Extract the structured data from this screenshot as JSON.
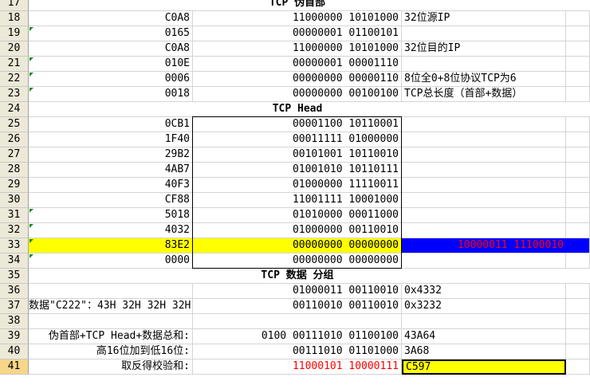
{
  "rows": [
    {
      "num": "17",
      "title": "TCP 伪首部"
    },
    {
      "num": "18",
      "a": "C0A8",
      "b": "11000000 10101000",
      "c": "32位源IP",
      "tri": false
    },
    {
      "num": "19",
      "a": "0165",
      "b": "00000001 01100101",
      "c": "",
      "tri": true
    },
    {
      "num": "20",
      "a": "C0A8",
      "b": "11000000 10101000",
      "c": "32位目的IP",
      "tri": false
    },
    {
      "num": "21",
      "a": "010E",
      "b": "00000001 00001110",
      "c": "",
      "tri": true
    },
    {
      "num": "22",
      "a": "0006",
      "b": "00000000 00000110",
      "c": "8位全0+8位协议TCP为6",
      "tri": true
    },
    {
      "num": "23",
      "a": "0018",
      "b": "00000000 00100100",
      "c": "TCP总长度（首部+数据）",
      "tri": true
    },
    {
      "num": "24",
      "title": "TCP Head"
    },
    {
      "num": "25",
      "a": "0CB1",
      "b": "00001100 10110001",
      "c": "",
      "tri": false
    },
    {
      "num": "26",
      "a": "1F40",
      "b": "00011111 01000000",
      "c": "",
      "tri": false
    },
    {
      "num": "27",
      "a": "29B2",
      "b": "00101001 10110010",
      "c": "",
      "tri": false
    },
    {
      "num": "28",
      "a": "4AB7",
      "b": "01001010 10110111",
      "c": "",
      "tri": false
    },
    {
      "num": "29",
      "a": "40F3",
      "b": "01000000 11110011",
      "c": "",
      "tri": false
    },
    {
      "num": "30",
      "a": "CF88",
      "b": "11001111 10001000",
      "c": "",
      "tri": false
    },
    {
      "num": "31",
      "a": "5018",
      "b": "01010000 00011000",
      "c": "",
      "tri": true
    },
    {
      "num": "32",
      "a": "4032",
      "b": "01000000 00110010",
      "c": "",
      "tri": true
    },
    {
      "num": "33",
      "a": "83E2",
      "b": "00000000 00000000",
      "c": "",
      "d": "10000011 11100010",
      "tri": true,
      "hl": true
    },
    {
      "num": "34",
      "a": "0000",
      "b": "00000000 00000000",
      "c": "",
      "tri": true
    },
    {
      "num": "35",
      "title": "TCP 数据 分组"
    },
    {
      "num": "36",
      "a": "",
      "b": "01000011 00110010",
      "c": "0x4332",
      "tri": false
    },
    {
      "num": "37",
      "a": "数据\"C222\"：43H 32H 32H 32H",
      "b": "00110010 00110010",
      "c": "0x3232",
      "tri": false
    },
    {
      "num": "38",
      "a": "",
      "b": "",
      "c": "",
      "tri": false
    },
    {
      "num": "39",
      "a": "伪首部+TCP Head+数据总和:",
      "b": "0100 00111010 01100100",
      "c": "43A64",
      "tri": false
    },
    {
      "num": "40",
      "a": "高16位加到低16位:",
      "b": "00111010 01101000",
      "c": "3A68",
      "tri": false
    },
    {
      "num": "41",
      "a": "取反得校验和:",
      "b": "11000101 10000111",
      "c": "C597",
      "tri": false,
      "red": true,
      "final": true
    }
  ],
  "colors": {
    "yellow": "#ffff00",
    "blue": "#0000ff",
    "red": "#ff0000",
    "grid": "#d4d4d4",
    "header": "#ece9d8"
  }
}
